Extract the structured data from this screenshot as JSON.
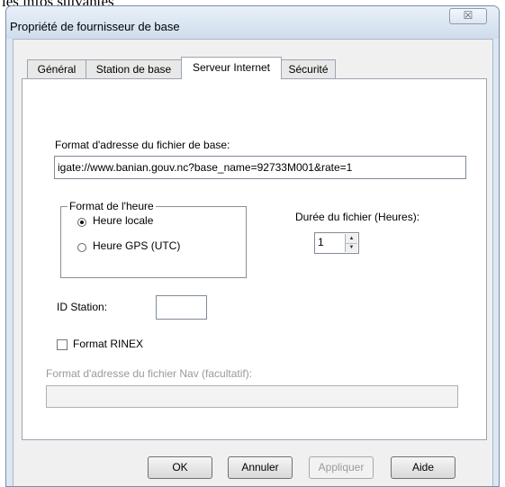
{
  "background_caption": "les infos suivantes",
  "window": {
    "title": "Propriété de fournisseur de base",
    "close_glyph": "☒"
  },
  "tabs": [
    {
      "label": "Général",
      "active": false
    },
    {
      "label": "Station de base",
      "active": false
    },
    {
      "label": "Serveur Internet",
      "active": true
    },
    {
      "label": "Sécurité",
      "active": false
    }
  ],
  "form": {
    "base_file_url_label": "Format d'adresse du fichier de base:",
    "base_file_url_value": "igate://www.banian.gouv.nc?base_name=92733M001&rate=1",
    "time_format_group": "Format de l'heure",
    "time_local_label": "Heure locale",
    "time_gps_label": "Heure GPS (UTC)",
    "time_local_selected": true,
    "duration_label": "Durée du fichier (Heures):",
    "duration_value": "1",
    "station_id_label": "ID Station:",
    "station_id_value": "",
    "rinex_label": "Format RINEX",
    "rinex_checked": false,
    "nav_url_label": "Format d'adresse du fichier Nav (facultatif):",
    "nav_url_value": ""
  },
  "buttons": {
    "ok": "OK",
    "cancel": "Annuler",
    "apply": "Appliquer",
    "help": "Aide"
  }
}
